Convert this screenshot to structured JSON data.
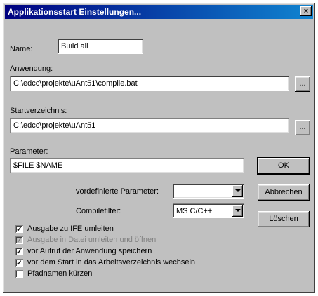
{
  "window": {
    "title": "Applikationsstart Einstellungen...",
    "close_glyph": "×"
  },
  "name": {
    "label": "Name:",
    "value": "Build all"
  },
  "anwendung": {
    "label": "Anwendung:",
    "value": "C:\\edcc\\projekte\\uAnt51\\compile.bat",
    "browse_label": "..."
  },
  "startverzeichnis": {
    "label": "Startverzeichnis:",
    "value": "C:\\edcc\\projekte\\uAnt51",
    "browse_label": "..."
  },
  "parameter": {
    "label": "Parameter:",
    "value": "$FILE $NAME"
  },
  "vordefinierte": {
    "label": "vordefinierte Parameter:",
    "value": ""
  },
  "compilefilter": {
    "label": "Compilefilter:",
    "value": "MS C/C++"
  },
  "buttons": {
    "ok": "OK",
    "abbrechen": "Abbrechen",
    "loeschen": "Löschen"
  },
  "checkboxes": [
    {
      "label": "Ausgabe zu IFE umleiten",
      "checked": true,
      "enabled": true
    },
    {
      "label": "Ausgabe in Datei umleiten und öffnen",
      "checked": true,
      "enabled": false
    },
    {
      "label": "vor Aufruf der Anwendung speichern",
      "checked": true,
      "enabled": true
    },
    {
      "label": "vor dem Start in das Arbeitsverzeichnis wechseln",
      "checked": true,
      "enabled": true
    },
    {
      "label": "Pfadnamen kürzen",
      "checked": false,
      "enabled": true
    }
  ]
}
